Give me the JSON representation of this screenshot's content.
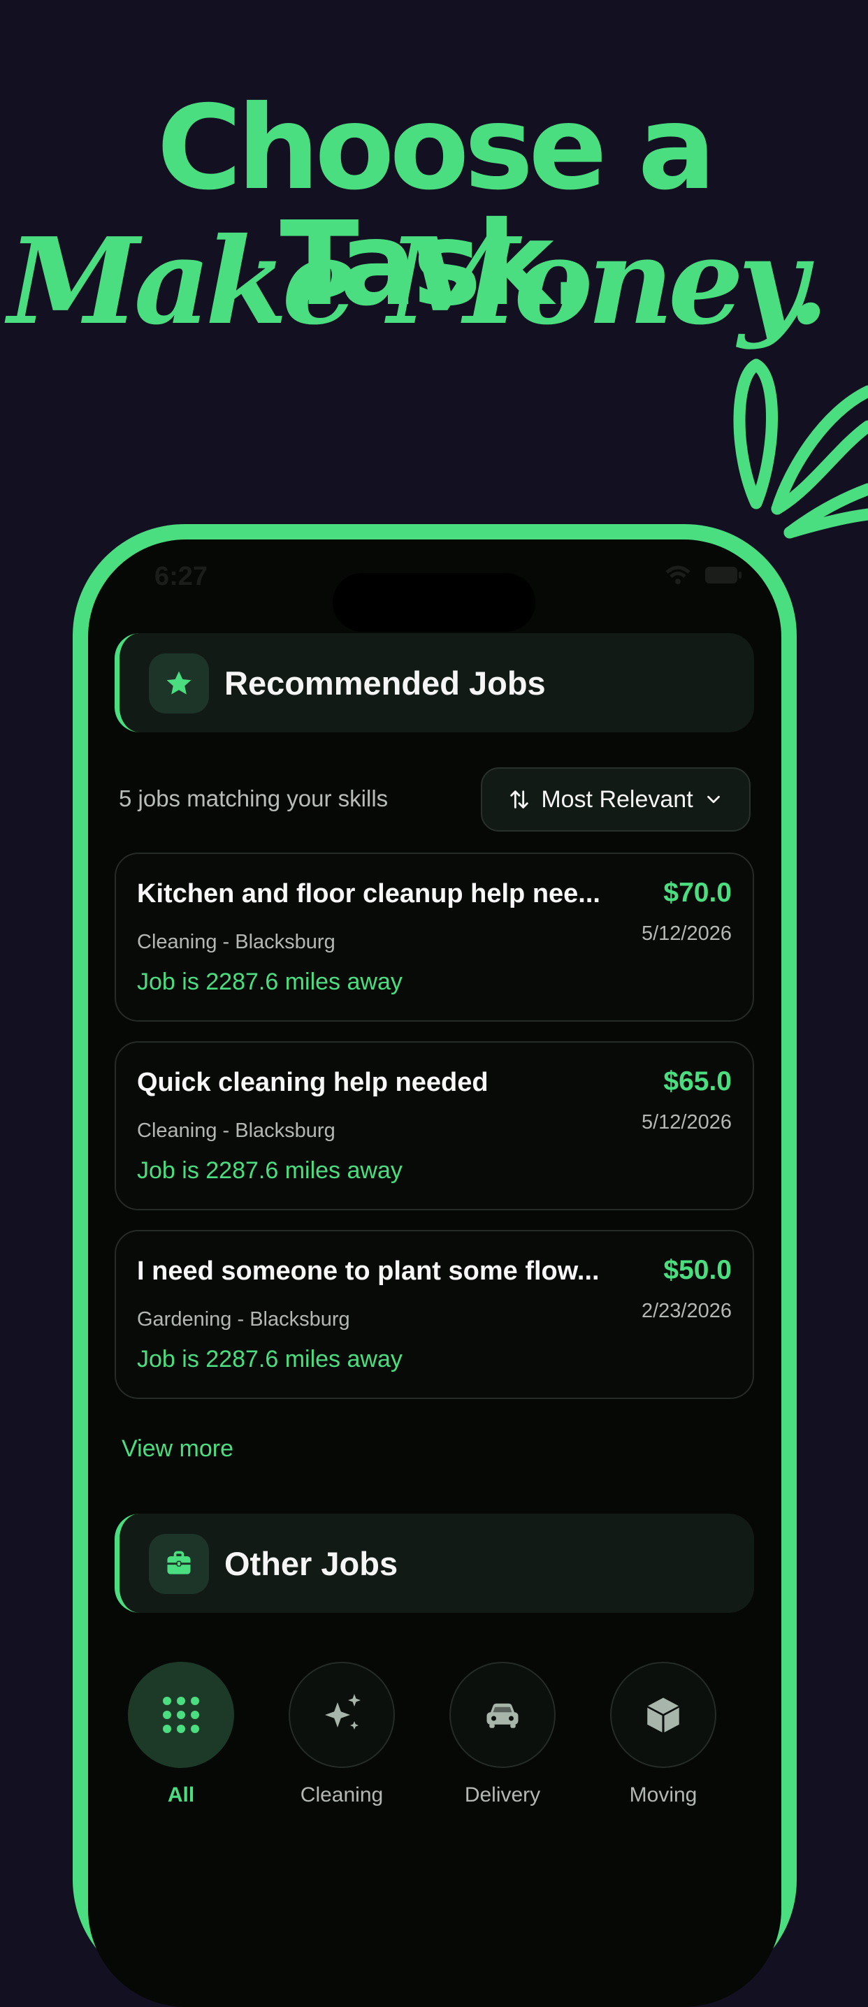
{
  "hero": {
    "line1": "Choose a Task.",
    "line2": "Make Money."
  },
  "status_bar": {
    "time": "6:27"
  },
  "recommended": {
    "title": "Recommended Jobs",
    "count_text": "5 jobs matching your skills",
    "sort_label": "Most Relevant",
    "jobs": [
      {
        "title": "Kitchen and floor cleanup help nee...",
        "price": "$70.0",
        "date": "5/12/2026",
        "category": "Cleaning - Blacksburg",
        "distance": "Job is 2287.6 miles away"
      },
      {
        "title": "Quick cleaning help needed",
        "price": "$65.0",
        "date": "5/12/2026",
        "category": "Cleaning - Blacksburg",
        "distance": "Job is 2287.6 miles away"
      },
      {
        "title": "I need someone to plant some flow...",
        "price": "$50.0",
        "date": "2/23/2026",
        "category": "Gardening - Blacksburg",
        "distance": "Job is 2287.6 miles away"
      }
    ],
    "view_more": "View more"
  },
  "other_jobs": {
    "title": "Other Jobs",
    "categories": [
      {
        "label": "All",
        "icon": "grid-icon",
        "active": true
      },
      {
        "label": "Cleaning",
        "icon": "sparkles-icon",
        "active": false
      },
      {
        "label": "Delivery",
        "icon": "car-icon",
        "active": false
      },
      {
        "label": "Moving",
        "icon": "box-icon",
        "active": false
      }
    ]
  },
  "colors": {
    "background": "#131022",
    "accent": "#4ade80",
    "screen": "#060806"
  }
}
